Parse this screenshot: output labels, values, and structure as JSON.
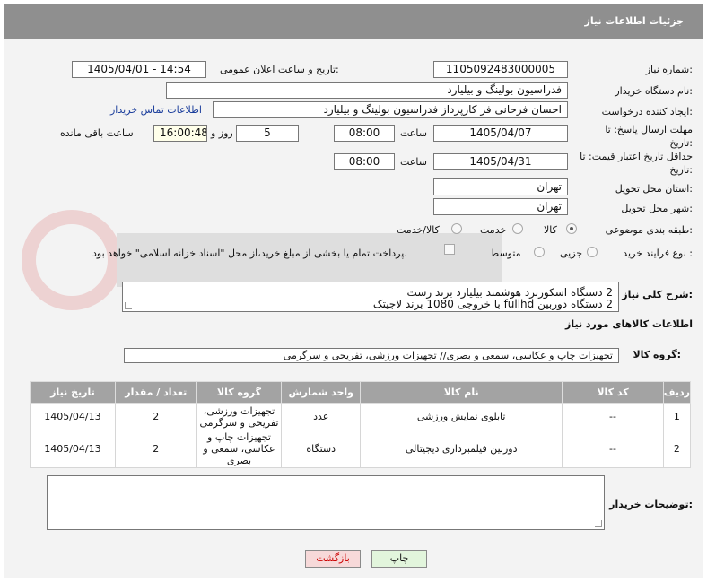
{
  "header": {
    "title": "جزئیات اطلاعات نیاز"
  },
  "fields": {
    "need_number_label": "شماره نیاز:",
    "need_number": "1105092483000005",
    "announce_label": "تاریخ و ساعت اعلان عمومی:",
    "announce_value": "1405/04/01 - 14:54",
    "buyer_org_label": "نام دستگاه خریدار:",
    "buyer_org": "فدراسیون بولینگ و بیلیارد",
    "requester_label": "ایجاد کننده درخواست:",
    "requester": "احسان  فرحانی فر کارپرداز فدراسیون بولینگ و بیلیارد",
    "contact_link": "اطلاعات تماس خریدار",
    "deadline_label": "مهلت ارسال پاسخ: تا تاریخ:",
    "deadline_date": "1405/04/07",
    "time_label": "ساعت",
    "deadline_time": "08:00",
    "days_value": "5",
    "days_label": "روز و",
    "remaining_time": "16:00:48",
    "remaining_label": "ساعت باقی مانده",
    "validity_label": "حداقل تاریخ اعتبار قیمت: تا تاریخ:",
    "validity_date": "1405/04/31",
    "validity_time": "08:00",
    "province_label": "استان محل تحویل:",
    "province": "تهران",
    "city_label": "شهر محل تحویل:",
    "city": "تهران",
    "category_label": "طبقه بندی موضوعی:",
    "category_options": [
      "کالا",
      "خدمت",
      "کالا/خدمت"
    ],
    "process_label": "نوع فرآیند خرید :",
    "process_options": [
      "جزیی",
      "متوسط"
    ],
    "process_note": "پرداخت تمام یا بخشی از مبلغ خرید،از محل \"اسناد خزانه اسلامی\" خواهد بود."
  },
  "description": {
    "label": "شرح کلی نیاز:",
    "lines": [
      "2 دستگاه اسکوربرد هوشمند بیلیارد برند رست",
      "2 دستگاه دوربین fullhd با خروجی 1080 برند لاجیتک"
    ]
  },
  "goods_section": {
    "title": "اطلاعات کالاهای مورد نیاز",
    "group_label": "گروه کالا:",
    "group_value": "تجهیزات چاپ و عکاسی، سمعی و بصری// تجهیزات ورزشی، تفریحی و سرگرمی"
  },
  "table": {
    "headers": [
      "ردیف",
      "کد کالا",
      "نام کالا",
      "واحد شمارش",
      "گروه کالا",
      "تعداد / مقدار",
      "تاریخ نیاز"
    ],
    "rows": [
      {
        "idx": "1",
        "code": "--",
        "name": "تابلوی نمایش ورزشی",
        "unit": "عدد",
        "group": "تجهیزات ورزشی، تفریحی و سرگرمی",
        "qty": "2",
        "date": "1405/04/13"
      },
      {
        "idx": "2",
        "code": "--",
        "name": "دوربین فیلمبرداری دیجیتالی",
        "unit": "دستگاه",
        "group": "تجهیزات چاپ و عکاسی، سمعی و بصری",
        "qty": "2",
        "date": "1405/04/13"
      }
    ]
  },
  "buyer_notes": {
    "label": "توضیحات خریدار:",
    "value": ""
  },
  "buttons": {
    "print": "چاپ",
    "back": "بازگشت"
  },
  "colors": {
    "title_bar": "#8f8f8f",
    "table_header": "#a3a3a3",
    "link": "#1b3e9c",
    "back_button": "#f7d9d9",
    "print_button": "#e2f5dc"
  }
}
